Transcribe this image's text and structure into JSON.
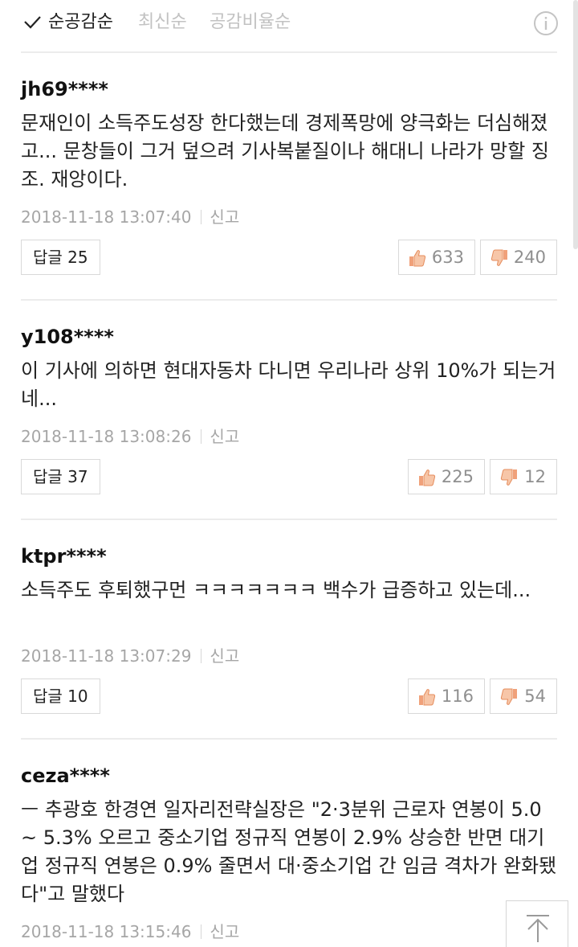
{
  "sort": {
    "options": [
      "순공감순",
      "최신순",
      "공감비율순"
    ]
  },
  "comments": [
    {
      "author": "jh69****",
      "text": "문재인이 소득주도성장 한다했는데 경제폭망에 양극화는 더심해졌고... 문창들이 그거 덮으려 기사복붙질이나 해대니 나라가 망할 징조. 재앙이다.",
      "time": "2018-11-18 13:07:40",
      "report": "신고",
      "reply": "답글 25",
      "up": "633",
      "down": "240"
    },
    {
      "author": "y108****",
      "text": "이 기사에 의하면 현대자동차 다니면 우리나라 상위 10%가 되는거네...",
      "time": "2018-11-18 13:08:26",
      "report": "신고",
      "reply": "답글 37",
      "up": "225",
      "down": "12"
    },
    {
      "author": "ktpr****",
      "text": "소득주도 후퇴했구먼 ㅋㅋㅋㅋㅋㅋㅋ 백수가 급증하고 있는데...",
      "time": "2018-11-18 13:07:29",
      "report": "신고",
      "reply": "답글 10",
      "up": "116",
      "down": "54"
    },
    {
      "author": "ceza****",
      "text": "ㅡ 추광호 한경연 일자리전략실장은 \"2·3분위 근로자 연봉이 5.0 ~ 5.3% 오르고 중소기업 정규직 연봉이 2.9% 상승한 반면 대기업 정규직 연봉은 0.9% 줄면서 대·중소기업 간 임금 격차가 완화됐다\"고 말했다",
      "time": "2018-11-18 13:15:46",
      "report": "신고"
    }
  ],
  "icons": {
    "sort_check": "checkmark-icon",
    "info": "info-icon",
    "like": "thumbs-up-icon",
    "dislike": "thumbs-down-icon",
    "scroll_top": "scroll-to-top-icon"
  },
  "colors": {
    "like_accent": "#f0a17a",
    "dislike_accent": "#f0a17a",
    "inactive_sort": "#c2c2c2",
    "meta_text": "#a6a6a6"
  }
}
